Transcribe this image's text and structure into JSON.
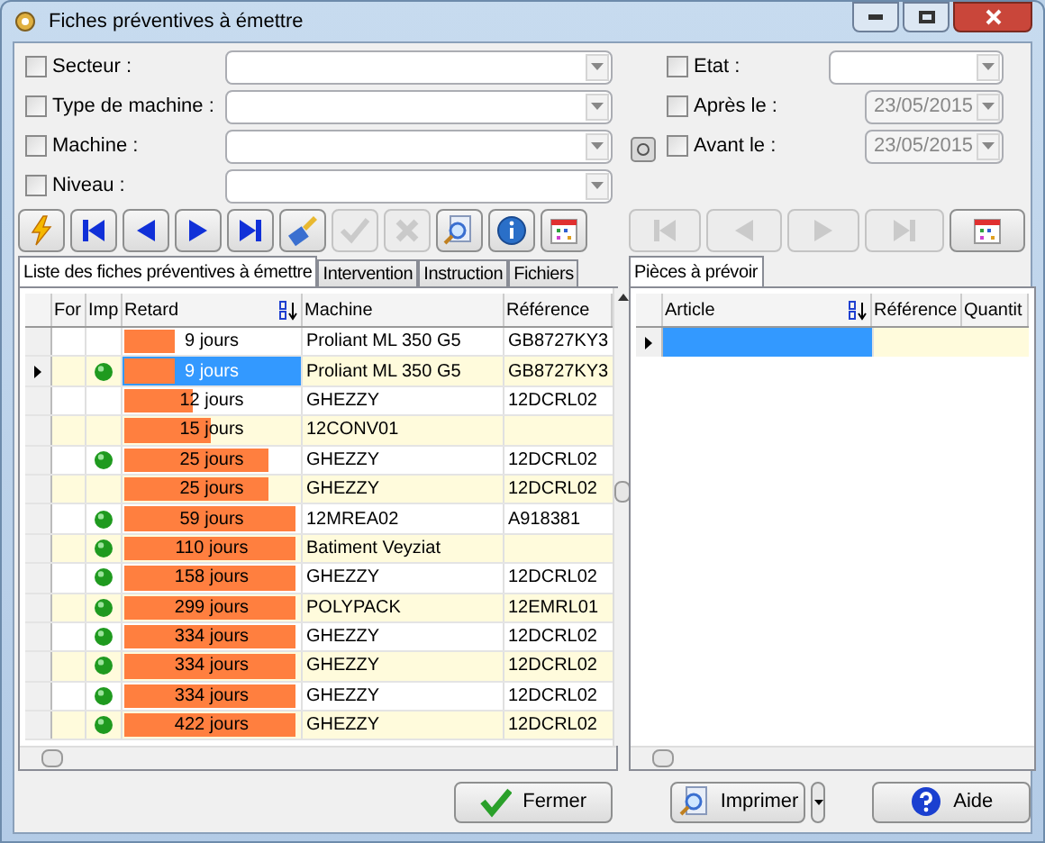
{
  "window": {
    "title": "Fiches préventives à émettre"
  },
  "filters_left": [
    {
      "label": "Secteur :",
      "checked": false
    },
    {
      "label": "Type de machine :",
      "checked": false
    },
    {
      "label": "Machine :",
      "checked": false
    },
    {
      "label": "Niveau :",
      "checked": false
    }
  ],
  "filters_right": [
    {
      "label": "Etat :",
      "checked": false,
      "kind": "combo"
    },
    {
      "label": "Après le :",
      "checked": false,
      "kind": "date",
      "value": "23/05/2015"
    },
    {
      "label": "Avant le :",
      "checked": false,
      "kind": "date",
      "value": "23/05/2015"
    }
  ],
  "toolbar_left": [
    {
      "kind": "lightning",
      "disabled": false
    },
    {
      "kind": "first",
      "disabled": false
    },
    {
      "kind": "prev",
      "disabled": false
    },
    {
      "kind": "next",
      "disabled": false
    },
    {
      "kind": "last",
      "disabled": false
    },
    {
      "kind": "brush",
      "disabled": false
    },
    {
      "kind": "check",
      "disabled": true
    },
    {
      "kind": "cross",
      "disabled": true
    },
    {
      "kind": "magnifier",
      "disabled": false
    },
    {
      "kind": "info",
      "disabled": false
    },
    {
      "kind": "calendar",
      "disabled": false
    }
  ],
  "toolbar_right": [
    {
      "kind": "first",
      "disabled": true
    },
    {
      "kind": "prev",
      "disabled": true
    },
    {
      "kind": "next",
      "disabled": true
    },
    {
      "kind": "last",
      "disabled": true
    },
    {
      "kind": "calendar",
      "disabled": false
    }
  ],
  "left_tabs": [
    {
      "label": "Liste des fiches préventives à émettre",
      "selected": true
    },
    {
      "label": "Intervention",
      "selected": false
    },
    {
      "label": "Instruction",
      "selected": false
    },
    {
      "label": "Fichiers",
      "selected": false
    }
  ],
  "left_table": {
    "columns": [
      "For",
      "Imp",
      "Retard",
      "Machine",
      "Référence"
    ],
    "rows": [
      {
        "imp": false,
        "retard": "9 jours",
        "level": 0.29,
        "machine": "Proliant ML 350 G5",
        "reference": "GB8727KY3",
        "selected": false
      },
      {
        "imp": true,
        "retard": "9 jours",
        "level": 0.29,
        "machine": "Proliant ML 350 G5",
        "reference": "GB8727KY3",
        "selected": true
      },
      {
        "imp": false,
        "retard": "12 jours",
        "level": 0.39,
        "machine": "GHEZZY",
        "reference": "12DCRL02",
        "selected": false
      },
      {
        "imp": false,
        "retard": "15 jours",
        "level": 0.49,
        "machine": "12CONV01",
        "reference": "",
        "selected": false
      },
      {
        "imp": true,
        "retard": "25 jours",
        "level": 0.82,
        "machine": "GHEZZY",
        "reference": "12DCRL02",
        "selected": false
      },
      {
        "imp": false,
        "retard": "25 jours",
        "level": 0.82,
        "machine": "GHEZZY",
        "reference": "12DCRL02",
        "selected": false
      },
      {
        "imp": true,
        "retard": "59 jours",
        "level": 0.98,
        "machine": "12MREA02",
        "reference": "A918381",
        "selected": false
      },
      {
        "imp": true,
        "retard": "110 jours",
        "level": 0.98,
        "machine": "Batiment Veyziat",
        "reference": "",
        "selected": false
      },
      {
        "imp": true,
        "retard": "158 jours",
        "level": 0.98,
        "machine": "GHEZZY",
        "reference": "12DCRL02",
        "selected": false
      },
      {
        "imp": true,
        "retard": "299 jours",
        "level": 0.98,
        "machine": "POLYPACK",
        "reference": "12EMRL01",
        "selected": false
      },
      {
        "imp": true,
        "retard": "334 jours",
        "level": 0.98,
        "machine": "GHEZZY",
        "reference": "12DCRL02",
        "selected": false
      },
      {
        "imp": true,
        "retard": "334 jours",
        "level": 0.98,
        "machine": "GHEZZY",
        "reference": "12DCRL02",
        "selected": false
      },
      {
        "imp": true,
        "retard": "334 jours",
        "level": 0.98,
        "machine": "GHEZZY",
        "reference": "12DCRL02",
        "selected": false
      },
      {
        "imp": true,
        "retard": "422 jours",
        "level": 0.98,
        "machine": "GHEZZY",
        "reference": "12DCRL02",
        "selected": false
      }
    ]
  },
  "right_tabs": [
    {
      "label": "Pièces à prévoir",
      "selected": true
    }
  ],
  "right_table": {
    "columns": [
      "Article",
      "Référence",
      "Quantit"
    ],
    "rows": [
      {
        "selected": true
      }
    ]
  },
  "buttons": [
    {
      "kind": "ok",
      "label": "Fermer"
    },
    {
      "kind": "print",
      "label": "Imprimer"
    },
    {
      "kind": "help",
      "label": "Aide"
    }
  ]
}
